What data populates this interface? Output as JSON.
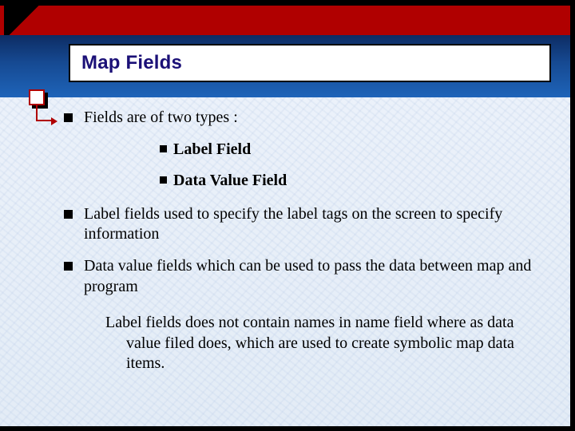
{
  "title": "Map Fields",
  "bullets": {
    "intro": "Fields are of two types :",
    "sub1": "Label  Field",
    "sub2": "Data Value  Field",
    "label_desc": "Label fields used to specify the label tags on the screen to specify information",
    "data_desc": "Data value fields which can be used to pass the data between map and program"
  },
  "note": "Label fields does not contain names in name field where as data value filed does, which are used  to create symbolic map  data items."
}
